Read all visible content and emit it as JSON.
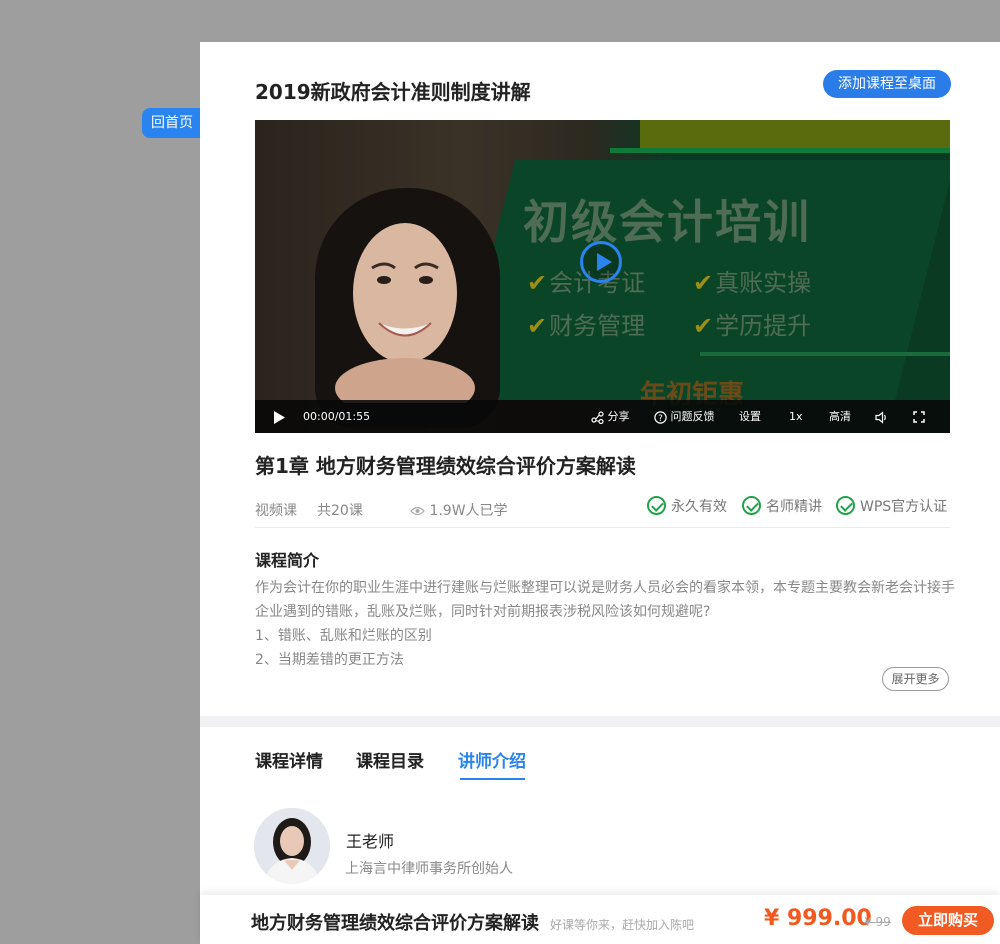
{
  "nav": {
    "home_label": "回首页"
  },
  "course": {
    "title": "2019新政府会计准则制度讲解",
    "add_to_desktop_label": "添加课程至桌面"
  },
  "video": {
    "banner_heading": "初级会计培训",
    "banner_items": [
      "会计考证",
      "真账实操",
      "财务管理",
      "学历提升"
    ],
    "banner_bottom_text": "年初钜惠",
    "controls": {
      "time": "00:00/01:55",
      "share_label": "分享",
      "feedback_label": "问题反馈",
      "settings_label": "设置",
      "speed_label": "1x",
      "quality_label": "高清"
    }
  },
  "chapter": {
    "title": "第1章  地方财务管理绩效综合评价方案解读"
  },
  "meta": {
    "type": "视频课",
    "lessons": "共20课",
    "learners": "1.9W人已学",
    "badges": [
      "永久有效",
      "名师精讲",
      "WPS官方认证"
    ]
  },
  "intro": {
    "title": "课程简介",
    "paragraphs": [
      "作为会计在你的职业生涯中进行建账与烂账整理可以说是财务人员必会的看家本领，本专题主要教会新老会计接手企业遇到的错账，乱账及烂账，同时针对前期报表涉税风险该如何规避呢?",
      "1、错账、乱账和烂账的区别",
      "2、当期差错的更正方法"
    ],
    "more_label": "展开更多"
  },
  "tabs": [
    {
      "label": "课程详情",
      "active": false
    },
    {
      "label": "课程目录",
      "active": false
    },
    {
      "label": "讲师介绍",
      "active": true
    }
  ],
  "teacher": {
    "name": "王老师",
    "role": "上海言中律师事务所创始人"
  },
  "buybar": {
    "title": "地方财务管理绩效综合评价方案解读",
    "slogan": "好课等你来，赶快加入陈吧",
    "price": "¥ 999.00",
    "original_price": "¥ 99",
    "buy_label": "立即购买"
  },
  "colors": {
    "accent_blue": "#2a84f0",
    "buy_orange": "#f15a22",
    "check_green": "#22a34a"
  }
}
